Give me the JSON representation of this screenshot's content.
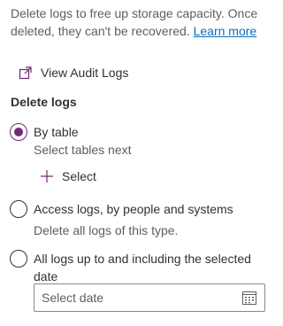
{
  "intro": {
    "text": "Delete logs to free up storage capacity. Once deleted, they can't be recovered.",
    "learn_more": "Learn more"
  },
  "audit_link": {
    "label": "View Audit Logs",
    "icon": "external-link-icon"
  },
  "delete_logs": {
    "title": "Delete logs",
    "options": [
      {
        "label": "By table",
        "selected": true,
        "description": "Select tables next",
        "action": "Select"
      },
      {
        "label": "Access logs, by people and systems",
        "selected": false,
        "description": "Delete all logs of this type."
      },
      {
        "label": "All logs up to and including the selected date",
        "selected": false
      }
    ],
    "date_placeholder": "Select date"
  },
  "colors": {
    "accent": "#742774",
    "link": "#0f6cbd"
  }
}
